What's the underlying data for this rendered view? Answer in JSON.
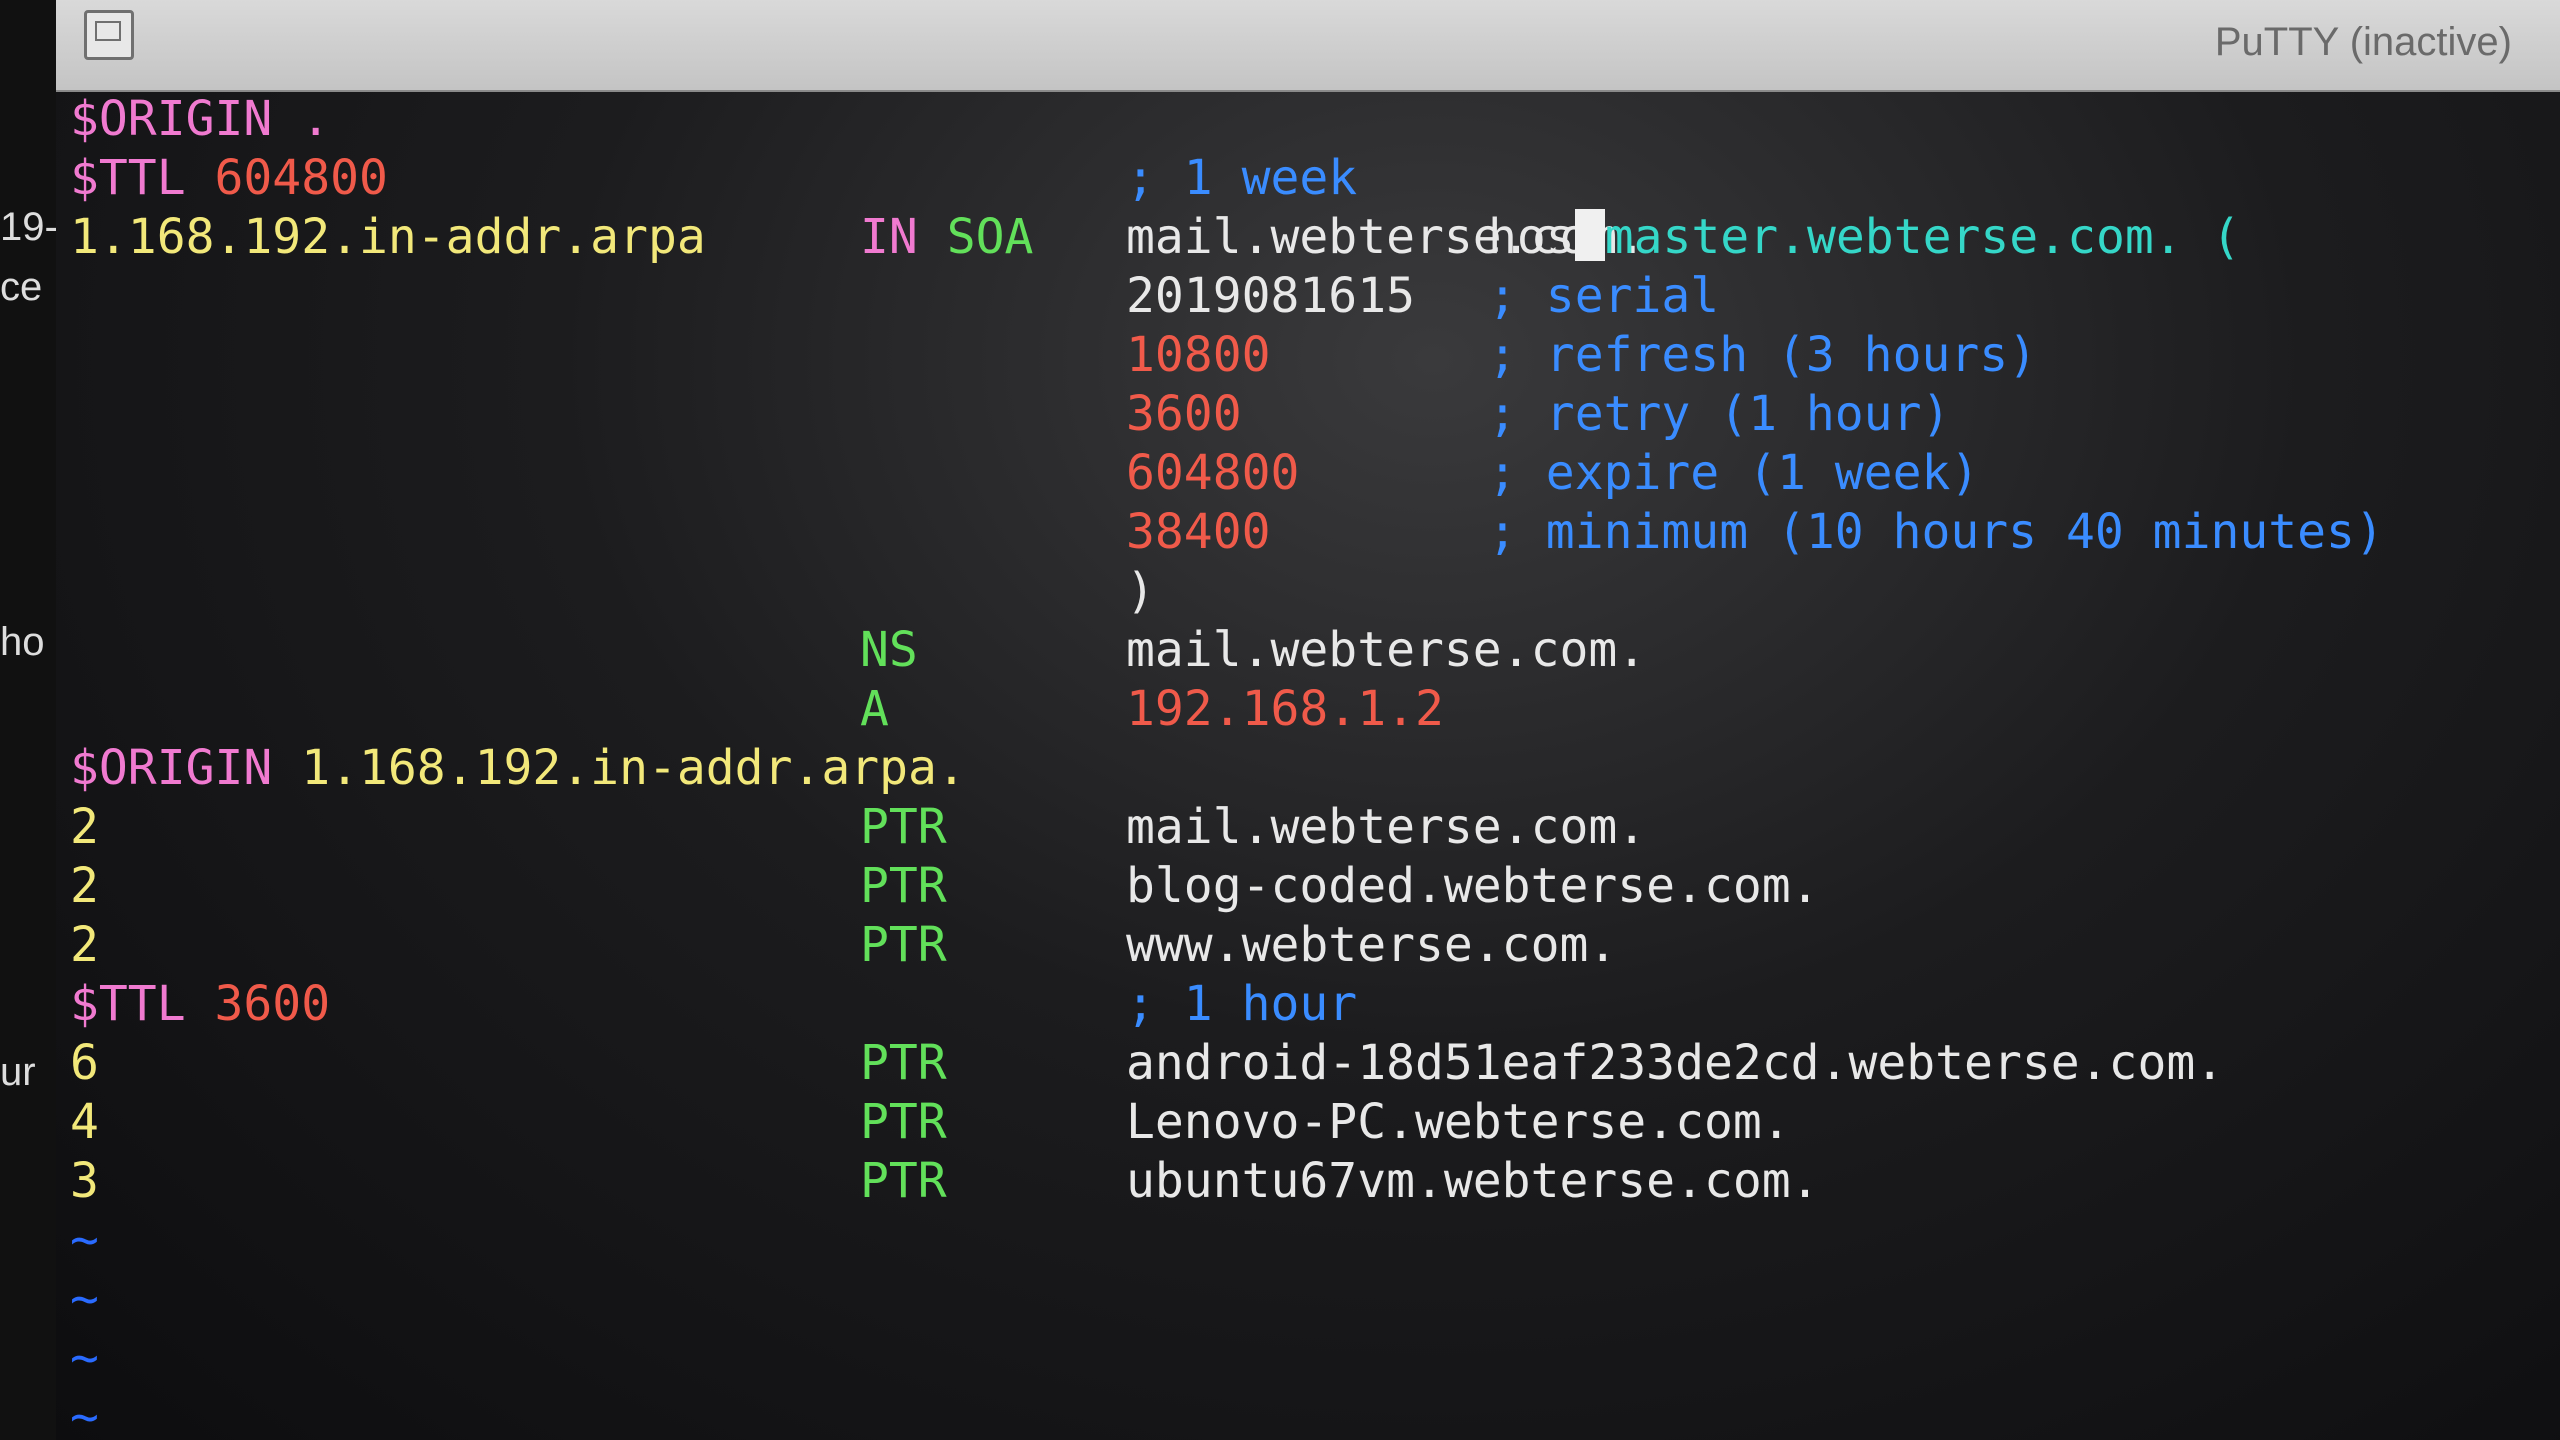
{
  "window": {
    "title": "PuTTY (inactive)"
  },
  "edge_fragments": [
    "19-",
    "ce",
    "ho",
    "ur"
  ],
  "lines": [
    {
      "c1": "$ORIGIN .",
      "c1c": "m"
    },
    {
      "c1": "$TTL ",
      "c1c": "m",
      "c1b": "604800",
      "c1bc": "r",
      "c3": "; 1 week",
      "c3c": "b"
    },
    {
      "c1": "1.168.192.in-addr.arpa",
      "c1c": "y",
      "c2": "IN",
      "c2c": "m",
      "c2b": " SOA",
      "c2bc": "g",
      "c3": "mail.webterse.com.",
      "c3c": "w",
      "c4": "hos",
      "c4c": "w",
      "cursor": true,
      "c4b": "master.webterse.com. (",
      "c4bc": "c"
    },
    {
      "c3": "2019081615",
      "c3c": "w",
      "c4": "; serial",
      "c4c": "b"
    },
    {
      "c3": "10800",
      "c3c": "r",
      "c4": "; refresh (3 hours)",
      "c4c": "b"
    },
    {
      "c3": "3600",
      "c3c": "r",
      "c4": "; retry (1 hour)",
      "c4c": "b"
    },
    {
      "c3": "604800",
      "c3c": "r",
      "c4": "; expire (1 week)",
      "c4c": "b"
    },
    {
      "c3": "38400",
      "c3c": "r",
      "c4": "; minimum (10 hours 40 minutes)",
      "c4c": "b"
    },
    {
      "c3": ")",
      "c3c": "w"
    },
    {
      "c2": "NS",
      "c2c": "g",
      "c3": "mail.webterse.com.",
      "c3c": "w"
    },
    {
      "c2": "A",
      "c2c": "g",
      "c3": "192.168.1.2",
      "c3c": "r"
    },
    {
      "c1": "$ORIGIN ",
      "c1c": "m",
      "c1b": "1.168.192.in-addr.arpa.",
      "c1bc": "y"
    },
    {
      "c1": "2",
      "c1c": "y",
      "c2": "PTR",
      "c2c": "g",
      "c3": "mail.webterse.com.",
      "c3c": "w"
    },
    {
      "c1": "2",
      "c1c": "y",
      "c2": "PTR",
      "c2c": "g",
      "c3": "blog-coded.webterse.com.",
      "c3c": "w"
    },
    {
      "c1": "2",
      "c1c": "y",
      "c2": "PTR",
      "c2c": "g",
      "c3": "www.webterse.com.",
      "c3c": "w"
    },
    {
      "c1": "$TTL ",
      "c1c": "m",
      "c1b": "3600",
      "c1bc": "r",
      "c3": "; 1 hour",
      "c3c": "b"
    },
    {
      "c1": "6",
      "c1c": "y",
      "c2": "PTR",
      "c2c": "g",
      "c3": "android-18d51eaf233de2cd.webterse.com.",
      "c3c": "w"
    },
    {
      "c1": "4",
      "c1c": "y",
      "c2": "PTR",
      "c2c": "g",
      "c3": "Lenovo-PC.webterse.com.",
      "c3c": "w"
    },
    {
      "c1": "3",
      "c1c": "y",
      "c2": "PTR",
      "c2c": "g",
      "c3": "ubuntu67vm.webterse.com.",
      "c3c": "w"
    },
    {
      "c1": "~",
      "c1c": "tilde"
    },
    {
      "c1": "~",
      "c1c": "tilde"
    },
    {
      "c1": "~",
      "c1c": "tilde"
    },
    {
      "c1": "~",
      "c1c": "tilde"
    }
  ]
}
